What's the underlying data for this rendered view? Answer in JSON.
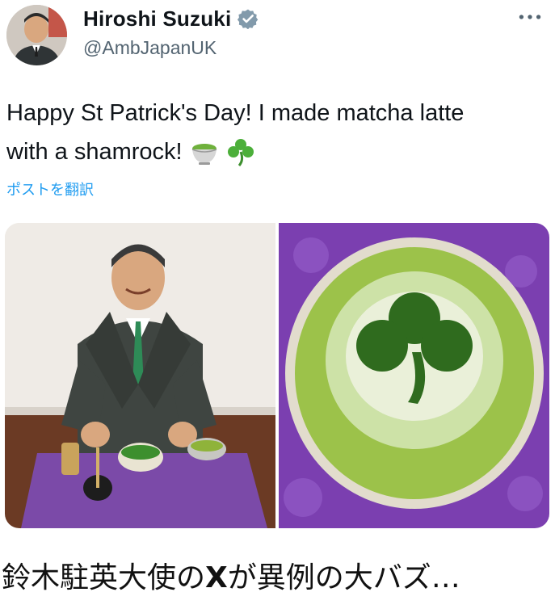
{
  "tweet": {
    "display_name": "Hiroshi Suzuki",
    "handle": "@AmbJapanUK",
    "verified_icon": "verified-badge-icon",
    "more_icon": "more-options-icon",
    "text_line1": "Happy St Patrick's Day! I made matcha latte",
    "text_line2": "with a shamrock!",
    "emoji": [
      "matcha-bowl-emoji",
      "shamrock-emoji"
    ],
    "translate_label": "ポストを翻訳",
    "media": [
      {
        "name": "photo-ambassador-tea-set"
      },
      {
        "name": "photo-matcha-latte-shamrock"
      }
    ]
  },
  "headline": {
    "prefix": "鈴木駐英大使の",
    "x_letter": "X",
    "suffix": "が異例の大バズ…"
  },
  "colors": {
    "text": "#0f1419",
    "secondary": "#536471",
    "link": "#1d9bf0",
    "matcha": "#6fa82f",
    "purple": "#6a3fa0"
  }
}
